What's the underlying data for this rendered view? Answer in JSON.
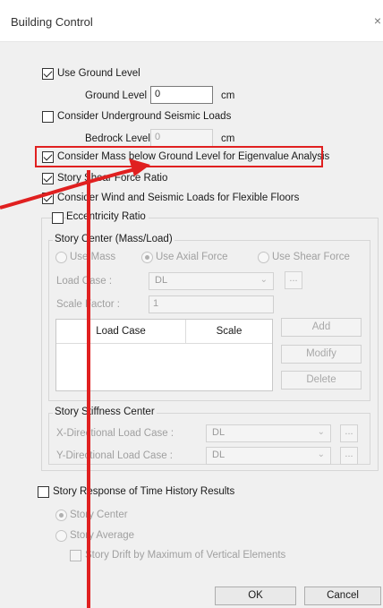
{
  "window": {
    "title": "Building Control",
    "close_glyph": "×"
  },
  "ground": {
    "use_ground_level_label": "Use Ground Level",
    "ground_level_label": "Ground Level :",
    "ground_level_value": "0",
    "ground_level_unit": "cm",
    "underground_label": "Consider Underground Seismic Loads",
    "bedrock_label": "Bedrock Level :",
    "bedrock_value": "0",
    "bedrock_unit": "cm",
    "mass_below_label": "Consider Mass below Ground Level for Eigenvalue Analysis",
    "story_shear_label": "Story Shear Force Ratio",
    "wind_seismic_label": "Consider Wind and Seismic Loads for Flexible Floors"
  },
  "eccentricity": {
    "label": "Eccentricity Ratio",
    "story_center_group": "Story Center (Mass/Load)",
    "radio_use_mass": "Use Mass",
    "radio_use_axial": "Use Axial Force",
    "radio_use_shear": "Use Shear Force",
    "load_case_label": "Load Case :",
    "load_case_value": "DL",
    "scale_factor_label": "Scale Factor :",
    "scale_factor_value": "1",
    "table_headers": [
      "Load Case",
      "Scale"
    ],
    "btn_add": "Add",
    "btn_modify": "Modify",
    "btn_delete": "Delete",
    "dots": "...",
    "stiffness_group": "Story Stiffness Center",
    "x_dir_label": "X-Directional Load Case :",
    "x_dir_value": "DL",
    "y_dir_label": "Y-Directional Load Case :",
    "y_dir_value": "DL"
  },
  "time_history": {
    "label": "Story Response of Time History Results",
    "radio_story_center": "Story Center",
    "radio_story_average": "Story Average",
    "drift_label": "Story Drift by Maximum of Vertical Elements"
  },
  "footer": {
    "ok": "OK",
    "cancel": "Cancel"
  },
  "colors": {
    "annotation": "#e02020"
  },
  "icons": {
    "chevron": "chevron-down-icon",
    "close": "close-icon"
  }
}
